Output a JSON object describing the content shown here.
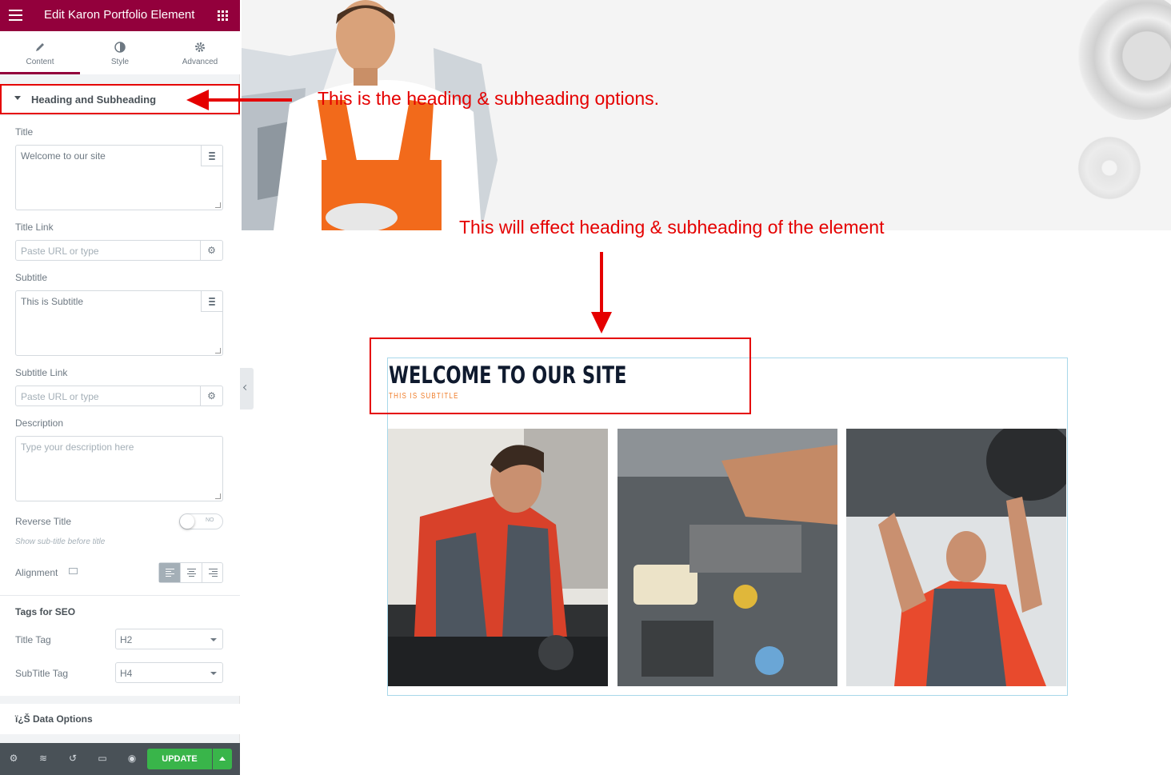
{
  "panel": {
    "header_title": "Edit Karon Portfolio Element",
    "tabs": [
      {
        "label": "Content",
        "icon": "pencil-icon",
        "active": true
      },
      {
        "label": "Style",
        "icon": "half-circle-icon",
        "active": false
      },
      {
        "label": "Advanced",
        "icon": "gear-icon",
        "active": false
      }
    ],
    "section_title": "Heading and Subheading",
    "title": {
      "label": "Title",
      "value": "Welcome to our site"
    },
    "title_link": {
      "label": "Title Link",
      "placeholder": "Paste URL or type"
    },
    "subtitle": {
      "label": "Subtitle",
      "value": "This is Subtitle"
    },
    "subtitle_link": {
      "label": "Subtitle Link",
      "placeholder": "Paste URL or type"
    },
    "description": {
      "label": "Description",
      "placeholder": "Type your description here"
    },
    "reverse_title": {
      "label": "Reverse Title",
      "toggle": "NO",
      "hint": "Show sub-title before title"
    },
    "alignment": {
      "label": "Alignment"
    },
    "seo": {
      "title": "Tags for SEO",
      "title_tag": {
        "label": "Title Tag",
        "value": "H2"
      },
      "subtitle_tag": {
        "label": "SubTitle Tag",
        "value": "H4"
      }
    },
    "data_section_title": "ï¿Š Data Options",
    "update_label": "UPDATE",
    "accent_color": "#93003c",
    "update_color": "#39b54a"
  },
  "annotations": {
    "arrow_text_1": "This is the heading & subheading options.",
    "arrow_text_2": "This will effect heading & subheading of the element"
  },
  "preview": {
    "heading": "WELCOME TO OUR SITE",
    "subheading": "THIS IS SUBTITLE"
  }
}
